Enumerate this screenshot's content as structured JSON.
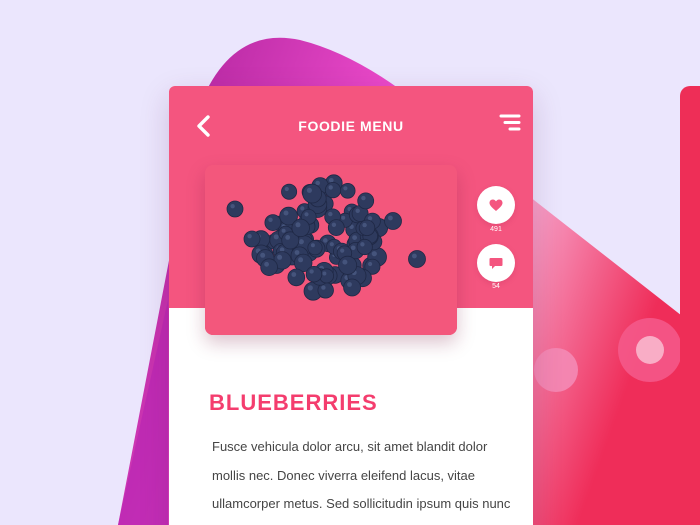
{
  "header": {
    "title": "FOODIE MENU",
    "back_icon": "chevron-left-icon",
    "menu_icon": "menu-lines-icon"
  },
  "hero": {
    "subject": "blueberries-photo"
  },
  "actions": {
    "likes": {
      "icon": "heart-icon",
      "count": "491"
    },
    "comments": {
      "icon": "chat-bubble-icon",
      "count": "54"
    }
  },
  "item": {
    "title": "BLUEBERRIES",
    "description": "Fusce vehicula dolor arcu, sit amet blandit dolor mollis nec. Donec viverra eleifend lacus, vitae ullamcorper metus. Sed sollicitudin ipsum quis nunc sollicitudin ultrices. Donec euismod"
  },
  "colors": {
    "background": "#ebe6fd",
    "accent_pink": "#f4557f",
    "title_pink": "#f43d6e",
    "blob_purple": "#9b1a8f",
    "blob_pink": "#f07ab6",
    "edge_red": "#ee2e57",
    "berry": "#2e3a5e"
  }
}
